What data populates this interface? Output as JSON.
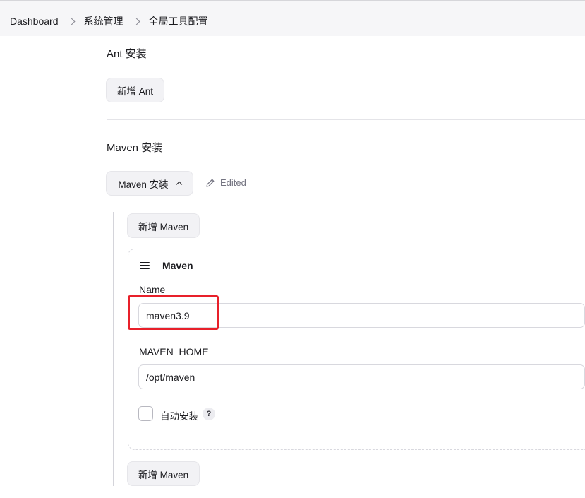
{
  "breadcrumb": {
    "items": [
      "Dashboard",
      "系统管理",
      "全局工具配置"
    ]
  },
  "ant": {
    "title": "Ant 安装",
    "add_button": "新增 Ant"
  },
  "maven": {
    "title": "Maven 安装",
    "toggle_button": "Maven 安装",
    "edited_label": "Edited",
    "add_button_top": "新增 Maven",
    "add_button_bottom": "新增 Maven",
    "card": {
      "header": "Maven",
      "name_label": "Name",
      "name_value": "maven3.9",
      "home_label": "MAVEN_HOME",
      "home_value": "/opt/maven",
      "auto_install_label": "自动安装",
      "auto_install_checked": false,
      "help_glyph": "?"
    }
  },
  "colors": {
    "highlight": "#e8202a",
    "button_bg": "#f2f2f5",
    "topbar_bg": "#f6f6f8"
  },
  "icons": {
    "edited": "pencil-icon",
    "toggle": "chevron-up-icon",
    "card_handle": "drag-handle-icon",
    "help": "help-icon"
  }
}
